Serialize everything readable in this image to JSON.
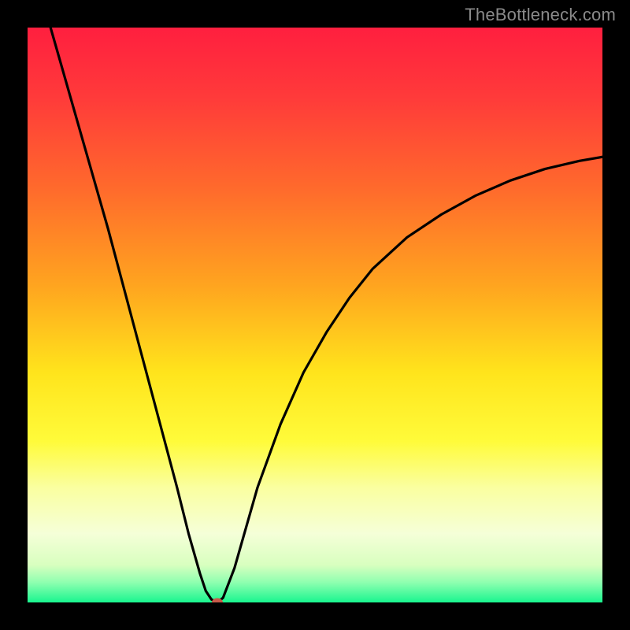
{
  "watermark": {
    "text": "TheBottleneck.com"
  },
  "chart_data": {
    "type": "line",
    "title": "",
    "xlabel": "",
    "ylabel": "",
    "xlim": [
      0,
      100
    ],
    "ylim": [
      0,
      100
    ],
    "background_gradient_stops": [
      {
        "pos": 0.0,
        "color": "#ff1f3f"
      },
      {
        "pos": 0.12,
        "color": "#ff3a3a"
      },
      {
        "pos": 0.28,
        "color": "#ff6a2c"
      },
      {
        "pos": 0.45,
        "color": "#ffa51f"
      },
      {
        "pos": 0.6,
        "color": "#ffe41c"
      },
      {
        "pos": 0.72,
        "color": "#fffb3a"
      },
      {
        "pos": 0.8,
        "color": "#faffa0"
      },
      {
        "pos": 0.88,
        "color": "#f5ffd8"
      },
      {
        "pos": 0.935,
        "color": "#d8ffbf"
      },
      {
        "pos": 0.965,
        "color": "#8fffb0"
      },
      {
        "pos": 1.0,
        "color": "#19f58f"
      }
    ],
    "series": [
      {
        "name": "bottleneck-curve",
        "x": [
          4,
          6,
          8,
          10,
          12,
          14,
          16,
          18,
          20,
          22,
          24,
          26,
          28,
          30,
          31,
          32,
          33,
          34,
          36,
          38,
          40,
          44,
          48,
          52,
          56,
          60,
          66,
          72,
          78,
          84,
          90,
          96,
          100
        ],
        "y": [
          100,
          93,
          86,
          79,
          72,
          65,
          57.5,
          50,
          42.5,
          35,
          27.5,
          20,
          12,
          5,
          2,
          0.5,
          0,
          0.8,
          6,
          13,
          20,
          31,
          40,
          47,
          53,
          58,
          63.5,
          67.5,
          70.8,
          73.4,
          75.4,
          76.8,
          77.5
        ]
      }
    ],
    "marker": {
      "x": 33,
      "y": 0,
      "color": "#c85a4a"
    }
  }
}
